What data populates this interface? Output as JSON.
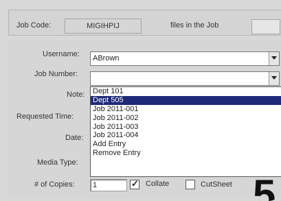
{
  "header": {
    "job_code_label": "Job Code:",
    "job_code_value": "MIGIHPIJ",
    "files_label": "files in the Job"
  },
  "form": {
    "username_label": "Username:",
    "username_value": "ABrown",
    "job_number_label": "Job Number:",
    "job_number_value": "",
    "note_label": "Note:",
    "requested_time_label": "Requested Time:",
    "date_label": "Date:",
    "media_type_label": "Media Type:",
    "copies_label": "# of Copies:",
    "copies_value": "1",
    "collate_label": "Collate",
    "collate_checked": true,
    "cutsheet_label": "CutSheet",
    "cutsheet_checked": false
  },
  "dropdown": {
    "items": [
      "Dept 101",
      "Dept 505",
      "Job 2011-001",
      "Job 2011-002",
      "Job 2011-003",
      "Job 2011-004",
      "Add Entry",
      "Remove Entry"
    ],
    "selected_index": 1,
    "selected_color": "#1e2a78"
  },
  "corner_glyph": "5"
}
